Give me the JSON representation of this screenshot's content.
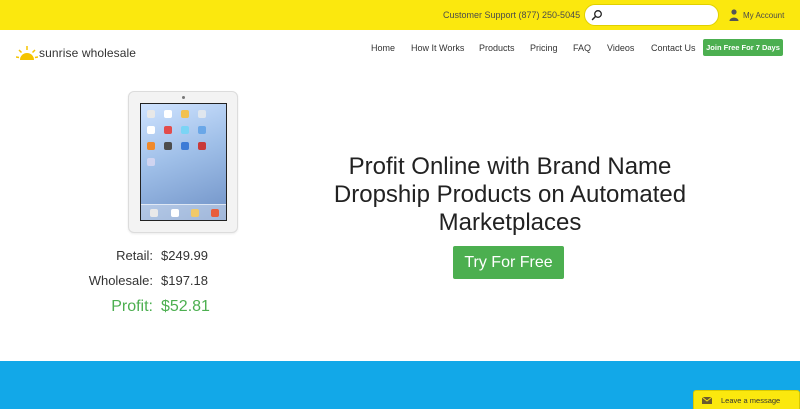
{
  "topbar": {
    "support_text": "Customer Support (877) 250-5045",
    "search_placeholder": "",
    "account_label": "My Account"
  },
  "brand": {
    "name": "sunrise wholesale"
  },
  "nav": {
    "items": [
      {
        "label": "Home"
      },
      {
        "label": "How It Works"
      },
      {
        "label": "Products"
      },
      {
        "label": "Pricing"
      },
      {
        "label": "FAQ"
      },
      {
        "label": "Videos"
      },
      {
        "label": "Contact Us"
      }
    ],
    "join_label": "Join Free For 7 Days"
  },
  "product": {
    "retail_label": "Retail:",
    "retail_value": "$249.99",
    "wholesale_label": "Wholesale:",
    "wholesale_value": "$197.18",
    "profit_label": "Profit:",
    "profit_value": "$52.81"
  },
  "hero": {
    "headline_line1": "Profit Online with Brand Name",
    "headline_line2": "Dropship Products on Automated",
    "headline_line3": "Marketplaces",
    "cta_label": "Try For Free"
  },
  "chat": {
    "label": "Leave a message"
  },
  "colors": {
    "topbar": "#fbe80e",
    "accent_green": "#4caf50",
    "band_blue": "#12a8e8"
  },
  "icons": {
    "search": "search-icon",
    "account": "user-icon",
    "logo": "sun-icon",
    "chat": "mail-icon"
  }
}
